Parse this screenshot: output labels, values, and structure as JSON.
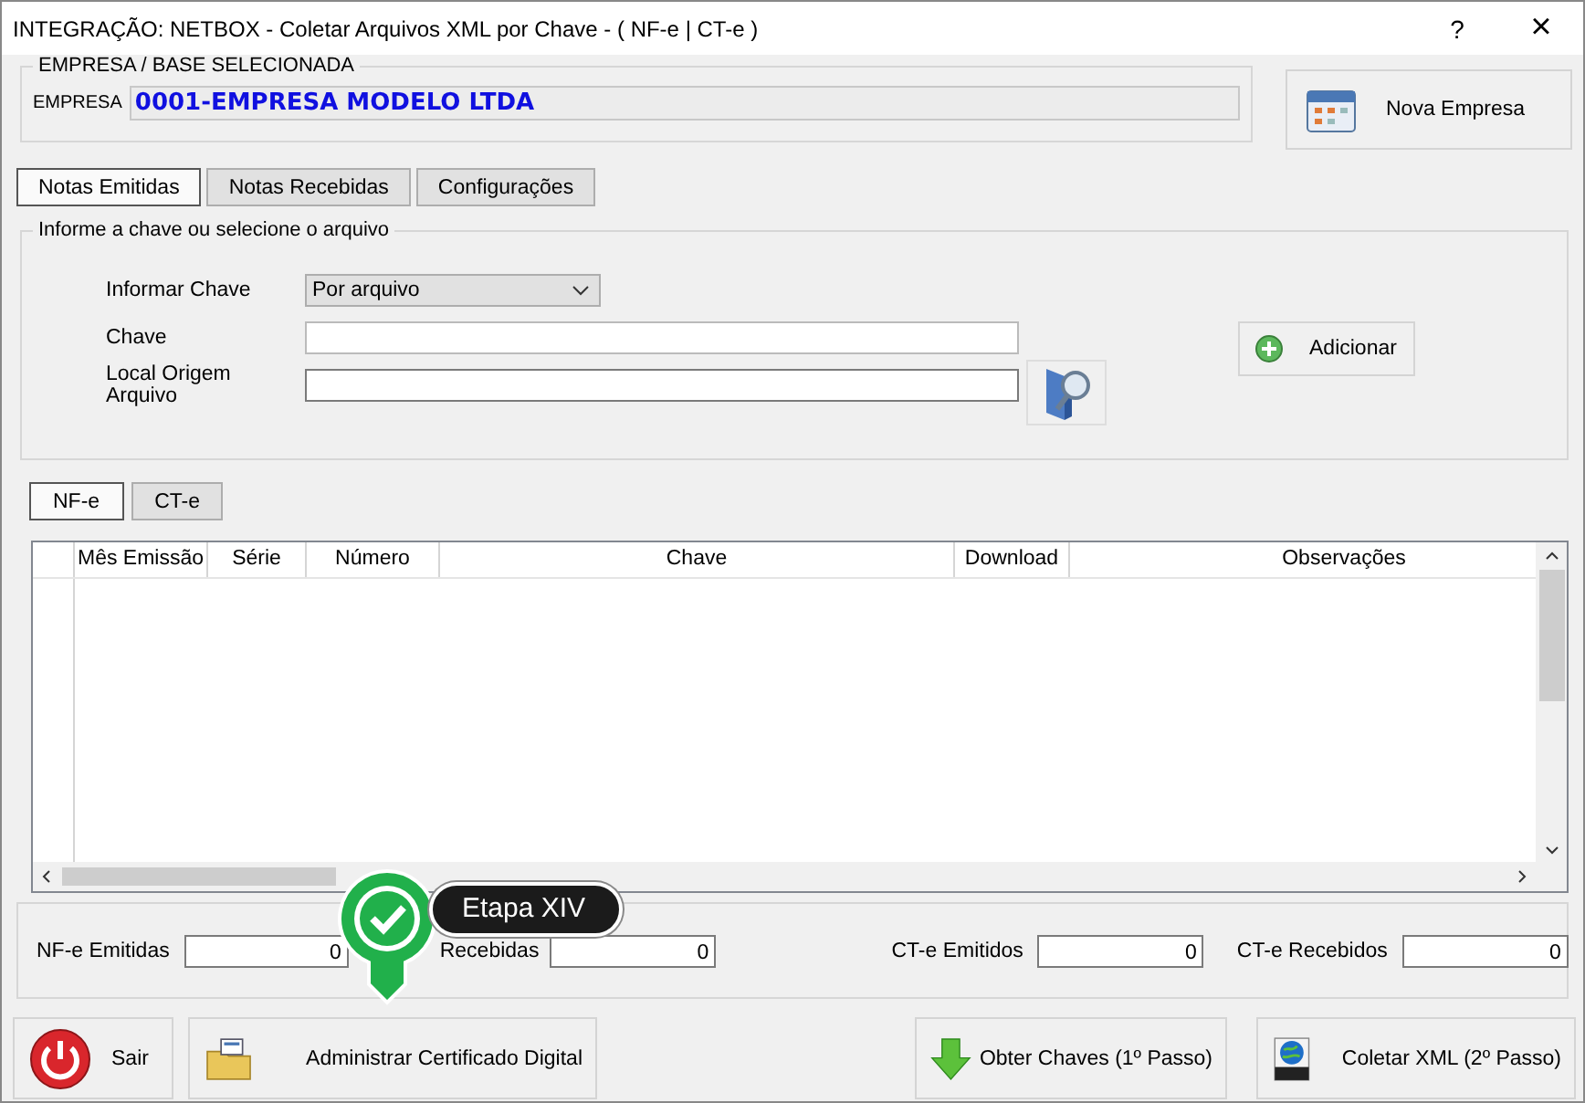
{
  "window": {
    "title": "INTEGRAÇÃO: NETBOX - Coletar Arquivos XML por Chave - ( NF-e | CT-e )",
    "help": "?",
    "close": "×"
  },
  "empresa": {
    "group_title": "EMPRESA  /  BASE  SELECIONADA",
    "label": "EMPRESA",
    "value": "0001-EMPRESA MODELO LTDA",
    "button": "Nova Empresa"
  },
  "tabs": [
    {
      "label": "Notas Emitidas",
      "selected": true
    },
    {
      "label": "Notas Recebidas",
      "selected": false
    },
    {
      "label": "Configurações",
      "selected": false
    }
  ],
  "form": {
    "group_title": "Informe a chave ou selecione o arquivo",
    "rows": [
      {
        "kind": "select",
        "label": "Informar Chave",
        "value": "Por arquivo"
      },
      {
        "kind": "text",
        "label": "Chave"
      },
      {
        "kind": "file",
        "label": "Local Origem Arquivo"
      }
    ],
    "add_button": "Adicionar"
  },
  "doc_tabs": [
    {
      "label": "NF-e",
      "selected": true
    },
    {
      "label": "CT-e",
      "selected": false
    }
  ],
  "table": {
    "columns": [
      "Mês Emissão",
      "Série",
      "Número",
      "Chave",
      "Download",
      "Observações"
    ]
  },
  "totals": [
    {
      "label": "NF-e Emitidas",
      "value": "0"
    },
    {
      "label": "Recebidas",
      "value": "0"
    },
    {
      "label": "CT-e Emitidos",
      "value": "0"
    },
    {
      "label": "CT-e Recebidos",
      "value": "0"
    }
  ],
  "buttons": [
    {
      "kind": "exit",
      "label": "Sair"
    },
    {
      "kind": "certificate",
      "label": "Administrar Certificado Digital"
    },
    {
      "kind": "download",
      "label": "Obter Chaves (1º Passo)"
    },
    {
      "kind": "xml",
      "label": "Coletar XML (2º Passo)"
    }
  ],
  "step_badge": {
    "label": "Etapa XIV"
  }
}
